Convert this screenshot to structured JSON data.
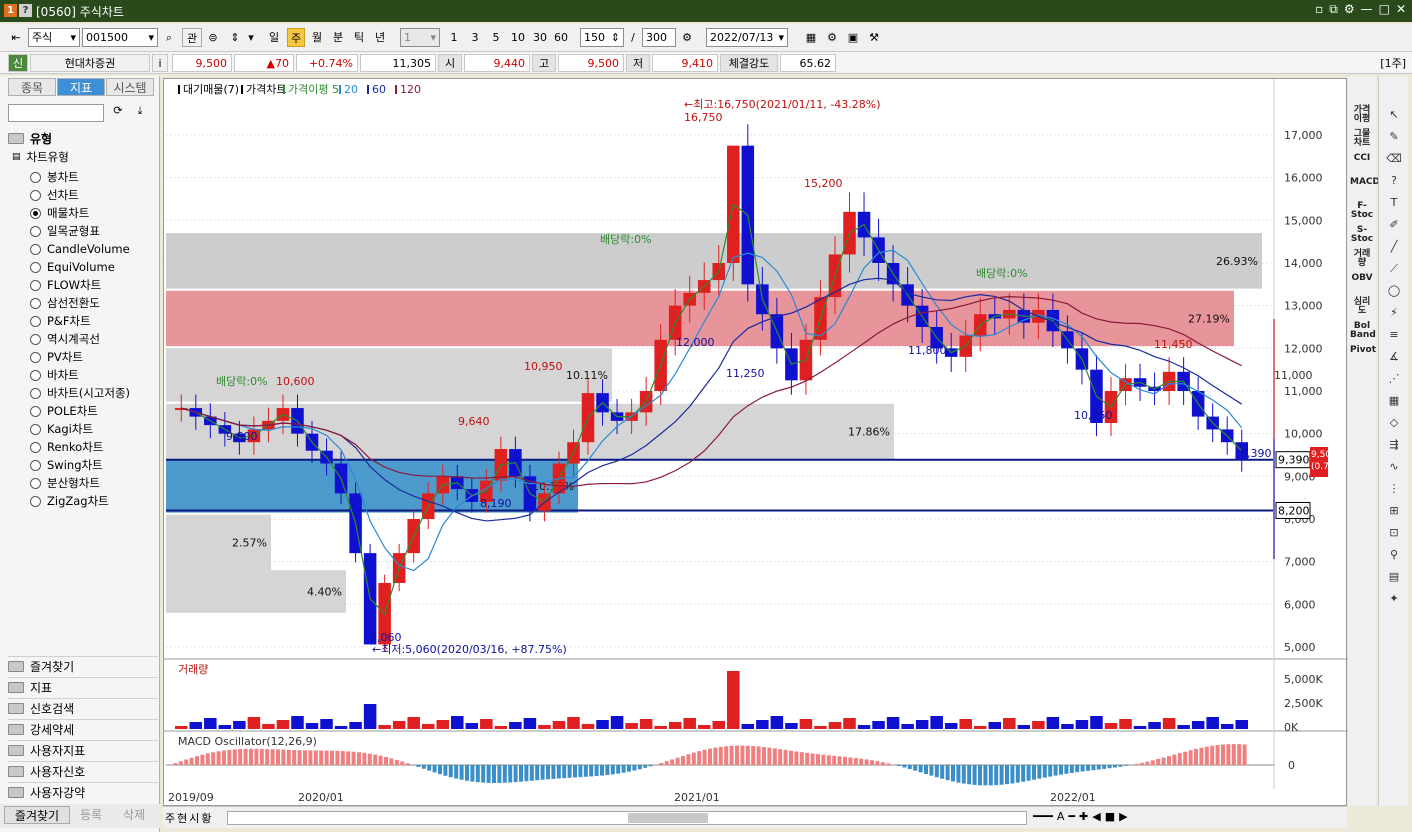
{
  "window": {
    "title": "[0560] 주식차트",
    "icon_labels": [
      "1",
      "?"
    ]
  },
  "toolbar": {
    "market": "주식",
    "code": "001500",
    "btn_gwan": "관",
    "periods": [
      "일",
      "주",
      "월",
      "분",
      "틱",
      "년"
    ],
    "active_period": "주",
    "interval": "1",
    "intervals": [
      "1",
      "3",
      "5",
      "10",
      "30",
      "60"
    ],
    "count": "150",
    "total": "300",
    "sep": "/",
    "date": "2022/07/13"
  },
  "infobar": {
    "badge": "신",
    "name": "현대차증권",
    "info_icon": "i",
    "price": "9,500",
    "change": "▲70",
    "change_pct": "+0.74%",
    "volume": "11,305",
    "open_label": "시",
    "open": "9,440",
    "high_label": "고",
    "high": "9,500",
    "low_label": "저",
    "low": "9,410",
    "strength_label": "체결강도",
    "strength": "65.62",
    "period_tag": "[1주]"
  },
  "left": {
    "tabs": [
      "종목",
      "지표",
      "시스템"
    ],
    "active_tab": "지표",
    "section_title": "유형",
    "tree_root": "차트유형",
    "chart_types": [
      "봉차트",
      "선차트",
      "매물차트",
      "일목균형표",
      "CandleVolume",
      "EquiVolume",
      "FLOW차트",
      "삼선전환도",
      "P&F차트",
      "역시계곡선",
      "PV차트",
      "바차트",
      "바차트(시고저종)",
      "POLE차트",
      "Kagi차트",
      "Renko차트",
      "Swing차트",
      "분산형차트",
      "ZigZag차트"
    ],
    "selected": "매물차트",
    "folders": [
      "즐겨찾기",
      "지표",
      "신호검색",
      "강세약세",
      "사용자지표",
      "사용자신호",
      "사용자강약"
    ],
    "bottom_buttons": [
      "즐겨찾기",
      "등록",
      "삭제"
    ]
  },
  "chart": {
    "legend": [
      "대기매물(7)",
      "가격차트",
      "가격이평 5",
      "20",
      "60",
      "120"
    ],
    "legend_colors": [
      "#000000",
      "#000000",
      "#2e8b2e",
      "#2a8ad4",
      "#1a2aa0",
      "#8b1a3a"
    ],
    "high_note": "←최고:16,750(2021/01/11, -43.28%)",
    "low_note": "←최저:5,060(2020/03/16, +87.75%)",
    "price_labels": [
      "16,750",
      "15,200",
      "12,000",
      "11,250",
      "11,800",
      "11,450",
      "10,250",
      "10,950",
      "9,640",
      "9,800",
      "10,600",
      "8,190",
      "5,060",
      "9,390",
      "11,000"
    ],
    "dividend_labels": [
      "배당락:0%",
      "배당락:0%",
      "배당락:0%"
    ],
    "volume_bands_pct": [
      "26.93%",
      "27.19%",
      "10.11%",
      "17.86%",
      "10.11%",
      "2.57%",
      "4.40%"
    ],
    "current_price_tag": "9,390",
    "current_price_tag2": "8,200",
    "current_pct_tag": "(0.74%)",
    "current_top_tag": "9,500",
    "y_ticks": [
      "17,000",
      "16,000",
      "15,000",
      "14,000",
      "13,000",
      "12,000",
      "11,000",
      "10,000",
      "9,000",
      "8,000",
      "7,000",
      "6,000",
      "5,000"
    ],
    "x_labels": [
      "2019/09",
      "2020/01",
      "2021/01",
      "2022/01"
    ],
    "volume_title": "거래량",
    "volume_ticks": [
      "5,000K",
      "2,500K",
      "0K"
    ],
    "macd_title": "MACD Oscillator(12,26,9)",
    "macd_tick": "0"
  },
  "chart_data": {
    "type": "candlestick",
    "x_range": [
      "2019/09",
      "2022/07"
    ],
    "ylim": [
      5000,
      17000
    ],
    "close_approx": [
      10600,
      10400,
      10200,
      10000,
      9800,
      10100,
      10300,
      10600,
      10000,
      9600,
      9300,
      8600,
      7200,
      5060,
      6500,
      7200,
      8000,
      8600,
      9000,
      8700,
      8400,
      8900,
      9640,
      9000,
      8190,
      8600,
      9300,
      9800,
      10950,
      10500,
      10300,
      10500,
      11000,
      12200,
      13000,
      13300,
      13600,
      14000,
      16750,
      13500,
      12800,
      12000,
      11250,
      12200,
      13200,
      14200,
      15200,
      14600,
      14000,
      13500,
      13000,
      12500,
      12000,
      11800,
      12300,
      12800,
      12700,
      12900,
      12600,
      12900,
      12400,
      12000,
      11500,
      10250,
      11000,
      11300,
      11100,
      11000,
      11450,
      11000,
      10400,
      10100,
      9800,
      9390
    ],
    "volume_profile_pct": [
      26.93,
      27.19,
      10.11,
      17.86,
      10.11,
      2.57,
      4.4
    ],
    "high": {
      "value": 16750,
      "date": "2021/01/11",
      "pct": -43.28
    },
    "low": {
      "value": 5060,
      "date": "2020/03/16",
      "pct": 87.75
    }
  },
  "right_strip": [
    "가격이평",
    "그물차트",
    "CCI",
    "MACD",
    "F-Stoc",
    "S-Stoc",
    "거래량",
    "OBV",
    "심리도",
    "Bol Band",
    "Pivot"
  ],
  "bottom": {
    "tabs": [
      "주",
      "현",
      "시",
      "황"
    ]
  }
}
